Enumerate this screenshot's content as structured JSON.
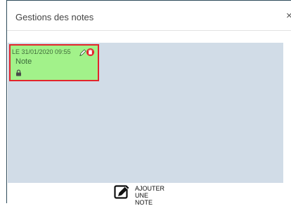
{
  "dialog": {
    "title": "Gestions des notes",
    "close_label": "×"
  },
  "notes": [
    {
      "date": "LE 31/01/2020 09:55",
      "title": "Note",
      "color": "#a2f28a",
      "border_color": "#e2252b",
      "icons": [
        "edit-icon",
        "delete-icon",
        "lock-icon"
      ]
    }
  ],
  "add_note": {
    "line1": "AJOUTER",
    "line2": "UNE NOTE",
    "icon": "pencil-square-icon"
  },
  "colors": {
    "area_background": "#d1dce7",
    "delete_red": "#e2252b"
  }
}
